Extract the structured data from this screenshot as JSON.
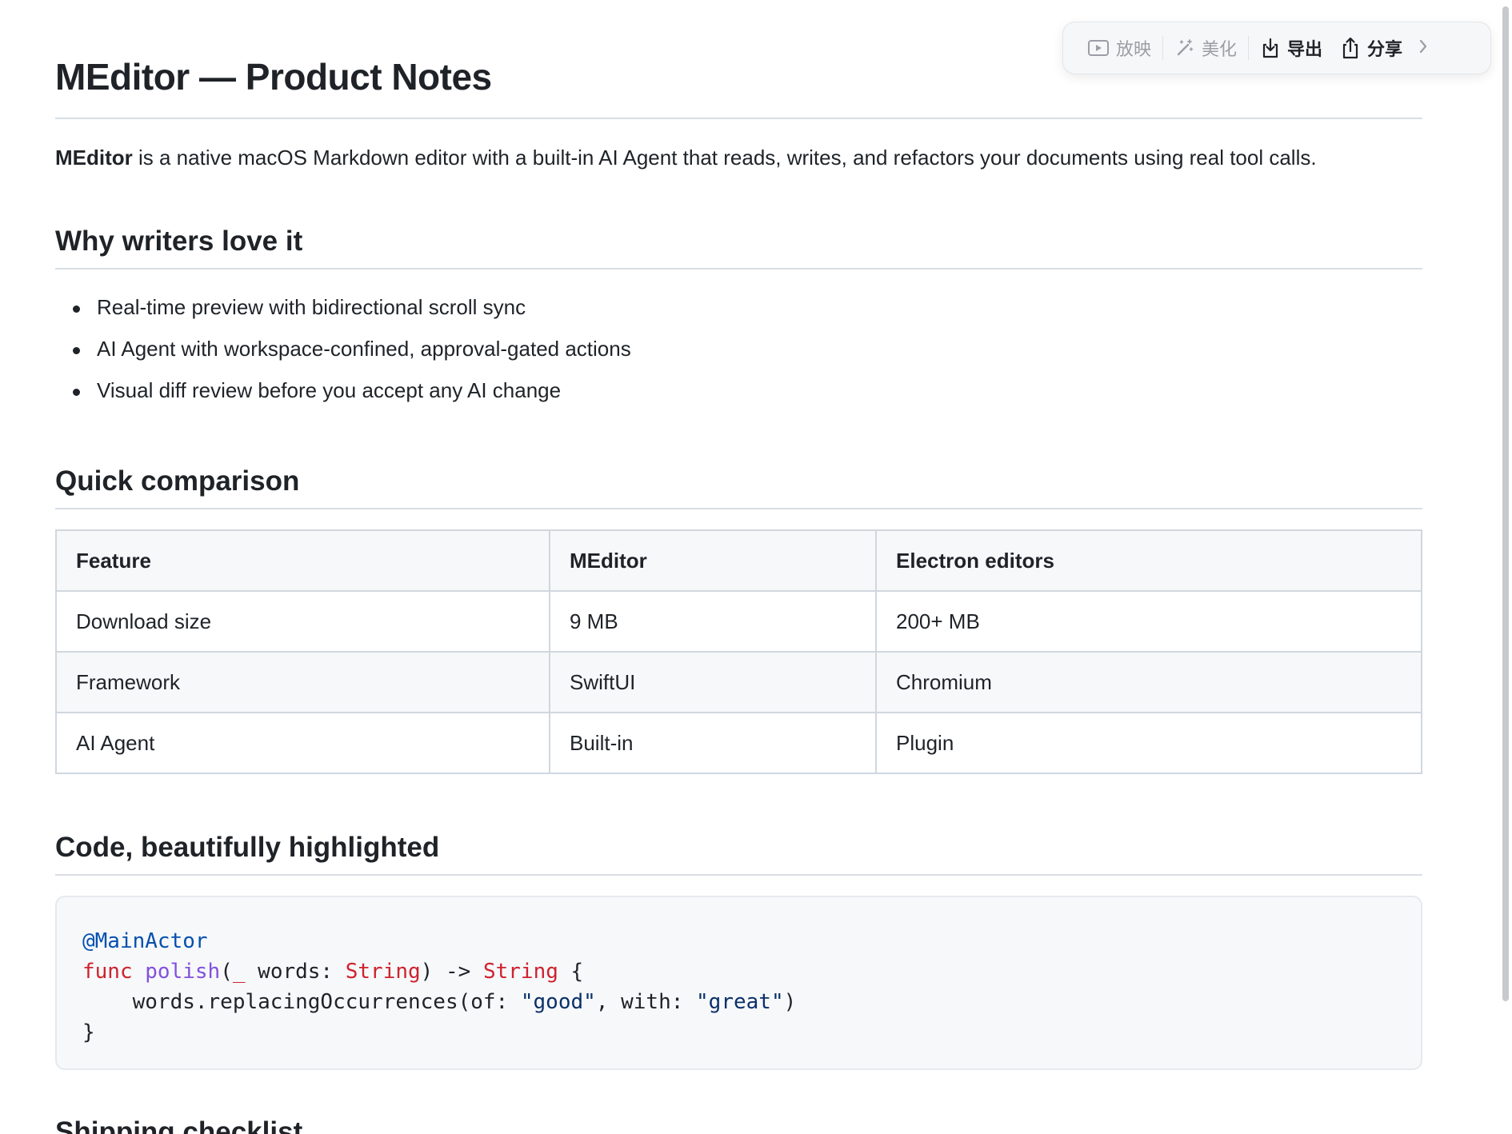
{
  "toolbar": {
    "present_label": "放映",
    "beautify_label": "美化",
    "export_label": "导出",
    "share_label": "分享"
  },
  "document": {
    "title": "MEditor — Product Notes",
    "intro": {
      "bold": "MEditor",
      "rest": " is a native macOS Markdown editor with a built-in AI Agent that reads, writes, and refactors your documents using real tool calls."
    },
    "sections": {
      "why": {
        "heading": "Why writers love it",
        "bullets": [
          "Real-time preview with bidirectional scroll sync",
          "AI Agent with workspace-confined, approval-gated actions",
          "Visual diff review before you accept any AI change"
        ]
      },
      "comparison": {
        "heading": "Quick comparison",
        "headers": [
          "Feature",
          "MEditor",
          "Electron editors"
        ],
        "rows": [
          [
            "Download size",
            "9 MB",
            "200+ MB"
          ],
          [
            "Framework",
            "SwiftUI",
            "Chromium"
          ],
          [
            "AI Agent",
            "Built-in",
            "Plugin"
          ]
        ]
      },
      "code": {
        "heading": "Code, beautifully highlighted",
        "line1": {
          "attr": "@MainActor"
        },
        "line2": {
          "kw": "func",
          "fn": "polish",
          "p1": "(",
          "underscore": "_",
          "p2": " words: ",
          "type1": "String",
          "p3": ") -> ",
          "type2": "String",
          "p4": " {"
        },
        "line3": {
          "p1": "    words.replacingOccurrences(of: ",
          "s1": "\"good\"",
          "p2": ", with: ",
          "s2": "\"great\"",
          "p3": ")"
        },
        "line4": "}"
      },
      "next": {
        "heading": "Shipping checklist"
      }
    }
  },
  "colors": {
    "text": "#1f2328",
    "muted": "#9a9ea5",
    "keyword": "#cf222e",
    "function": "#8250df",
    "attribute": "#0550ae",
    "string": "#0a3069",
    "rule": "#d8dee4",
    "table_border": "#d0d7de",
    "code_bg": "#f6f8fa"
  }
}
